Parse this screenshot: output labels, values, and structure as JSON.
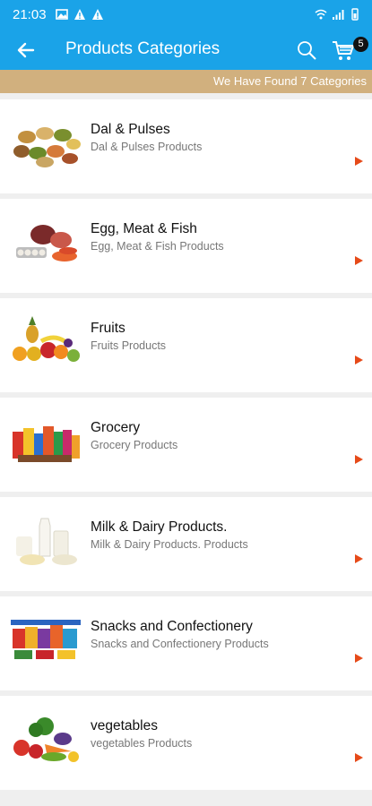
{
  "status_bar": {
    "time": "21:03"
  },
  "app_bar": {
    "title": "Products Categories",
    "cart_count": "5"
  },
  "found_text": "We Have Found 7 Categories",
  "categories": [
    {
      "name": "Dal & Pulses",
      "subtitle": "Dal & Pulses Products"
    },
    {
      "name": "Egg, Meat & Fish",
      "subtitle": "Egg, Meat & Fish Products"
    },
    {
      "name": "Fruits",
      "subtitle": "Fruits Products"
    },
    {
      "name": "Grocery",
      "subtitle": "Grocery Products"
    },
    {
      "name": "Milk & Dairy Products.",
      "subtitle": "Milk & Dairy Products. Products"
    },
    {
      "name": "Snacks and Confectionery",
      "subtitle": "Snacks and Confectionery Products"
    },
    {
      "name": "vegetables",
      "subtitle": "vegetables Products"
    }
  ],
  "colors": {
    "primary": "#1aa3e8",
    "banner": "#d1b07e",
    "arrow": "#e64a19"
  }
}
